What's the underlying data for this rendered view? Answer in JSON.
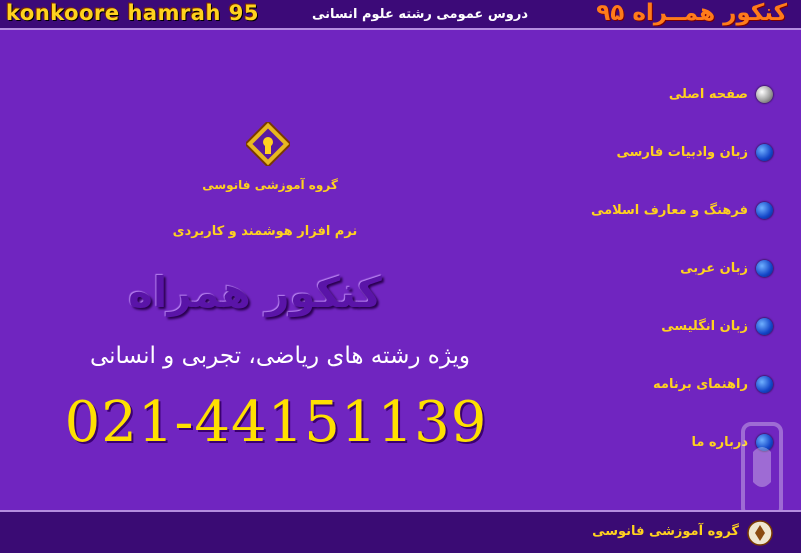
{
  "header": {
    "title_en": "konkoore hamrah 95",
    "subtitle": "دروس عمومی رشته علوم انسانی",
    "title_fa": "کنکور همــراه ۹۵"
  },
  "main": {
    "logo_caption": "گروه آموزشی فانوسی",
    "tagline": "نرم افزار هوشمند و کاربردی",
    "brand": "کنکور همراه",
    "fields": "ویژه رشته های ریاضی، تجربی و انسانی",
    "phone": "021-44151139"
  },
  "menu": {
    "items": [
      {
        "label": "صفحه اصلی",
        "active": true
      },
      {
        "label": "زبان وادبیات فارسی"
      },
      {
        "label": "فرهنگ و معارف اسلامی"
      },
      {
        "label": "زبان عربی"
      },
      {
        "label": "زبان انگلیسی"
      },
      {
        "label": "راهنمای برنامه"
      },
      {
        "label": "درباره ما"
      }
    ]
  },
  "footer": {
    "group_name": "گروه آموزشی فانوسی"
  },
  "colors": {
    "background": "#7025c0",
    "header": "#3c0a78",
    "accent_yellow": "#ffd21f",
    "title_orange": "#ff7b1a"
  },
  "icons": {
    "logo": "lantern-logo-icon",
    "bullet": "blue-orb-bullet-icon",
    "watermark": "phone-watermark-icon"
  }
}
